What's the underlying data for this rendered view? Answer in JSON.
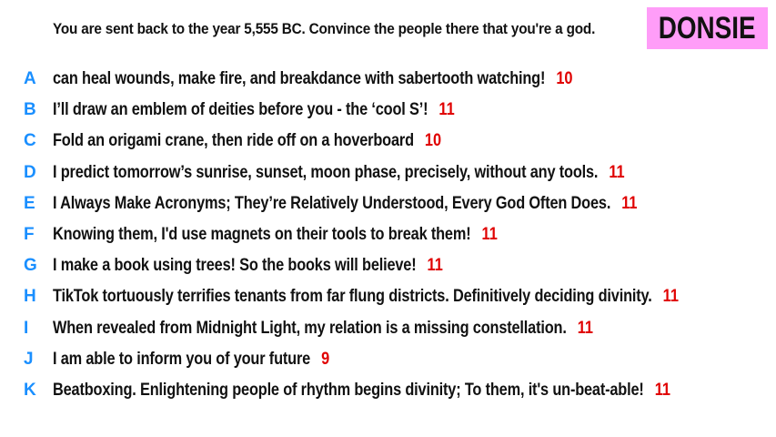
{
  "prompt": "You are sent back to the year 5,555 BC. Convince the people there that you're a god.",
  "player": {
    "name": "DONSIE",
    "badge_color": "#ff9df8"
  },
  "colors": {
    "letter": "#1a8fff",
    "score": "#e00000",
    "text": "#111111"
  },
  "answers": [
    {
      "letter": "A",
      "text": "can heal wounds, make fire, and breakdance with sabertooth watching!",
      "score": "10"
    },
    {
      "letter": "B",
      "text": "I’ll draw an emblem of deities before you - the ‘cool S’!",
      "score": "11"
    },
    {
      "letter": "C",
      "text": "Fold an origami crane, then ride off on a hoverboard",
      "score": "10"
    },
    {
      "letter": "D",
      "text": "I predict tomorrow’s sunrise, sunset, moon phase, precisely, without any tools.",
      "score": "11"
    },
    {
      "letter": "E",
      "text": "I Always Make Acronyms; They’re Relatively Understood, Every God Often Does.",
      "score": "11"
    },
    {
      "letter": "F",
      "text": "Knowing them, I'd use magnets on their tools to break them!",
      "score": "11"
    },
    {
      "letter": "G",
      "text": "I make a book using trees! So the books will believe!",
      "score": "11"
    },
    {
      "letter": "H",
      "text": "TikTok tortuously terrifies tenants from far flung districts. Definitively deciding divinity.",
      "score": "11"
    },
    {
      "letter": "I",
      "text": "When revealed from Midnight Light, my relation is a missing constellation.",
      "score": "11"
    },
    {
      "letter": "J",
      "text": "I am able to inform you of your future",
      "score": "9"
    },
    {
      "letter": "K",
      "text": "Beatboxing. Enlightening people of rhythm begins divinity; To them, it's un-beat-able!",
      "score": "11"
    }
  ]
}
